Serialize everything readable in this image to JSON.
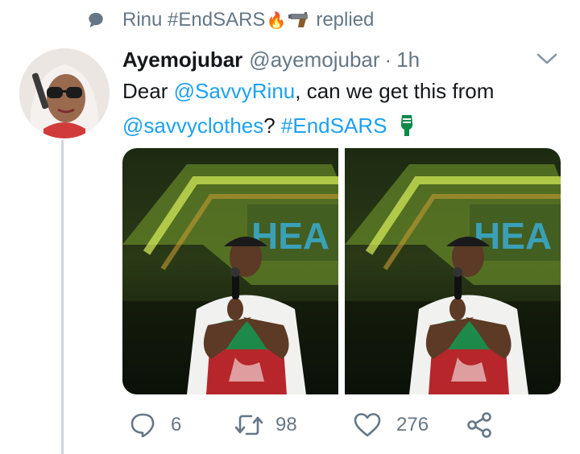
{
  "context": {
    "text": "Rinu #EndSARS",
    "emoji": "🔥",
    "suffix": "replied",
    "icon": "speech-bubble-icon"
  },
  "tweet": {
    "author_name": "Ayemojubar",
    "handle": "@ayemojubar",
    "separator": "·",
    "time": "1h",
    "text": {
      "p1": "Dear ",
      "mention1": "@SavvyRinu",
      "p2": ", can we get this from ",
      "mention2": "@savvyclothes",
      "p3": "? ",
      "hashtag": "#EndSARS"
    },
    "media_count": 2
  },
  "actions": {
    "replies": "6",
    "retweets": "98",
    "likes": "276"
  },
  "colors": {
    "accent": "#1da1f2",
    "muted": "#657786",
    "line": "#ccd6dd"
  }
}
